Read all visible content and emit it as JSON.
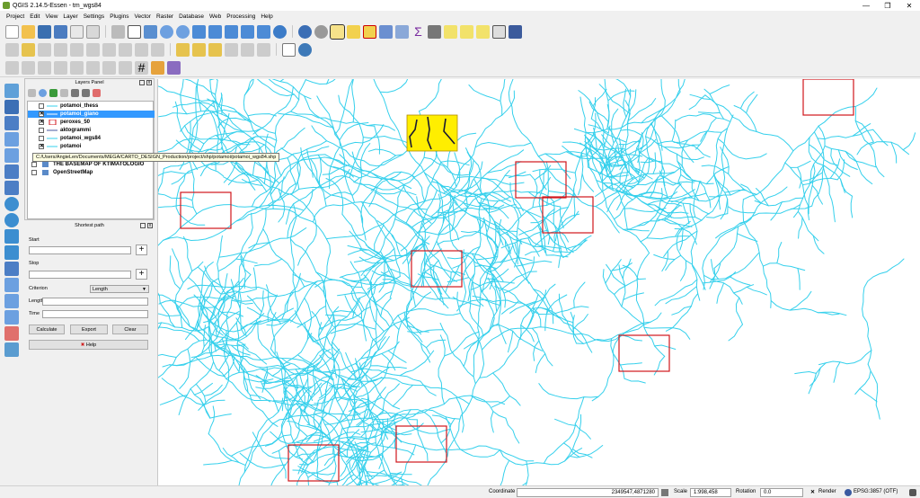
{
  "window": {
    "title": "QGIS 2.14.5-Essen - tm_wgs84",
    "min_label": "—",
    "max_label": "❐",
    "close_label": "✕"
  },
  "menu": [
    "Project",
    "Edit",
    "View",
    "Layer",
    "Settings",
    "Plugins",
    "Vector",
    "Raster",
    "Database",
    "Web",
    "Processing",
    "Help"
  ],
  "layers_panel": {
    "title": "Layers Panel",
    "layers": [
      {
        "name": "potamoi_thess",
        "checked": false,
        "selected": false,
        "symbol": "line"
      },
      {
        "name": "potamoi_giano",
        "checked": true,
        "selected": true,
        "symbol": "line"
      },
      {
        "name": "peroxes_50",
        "checked": true,
        "selected": false,
        "symbol": "poly-red"
      },
      {
        "name": "aktogrammi",
        "checked": false,
        "selected": false,
        "symbol": "line-dark"
      },
      {
        "name": "potamoi_wgs84",
        "checked": false,
        "selected": false,
        "symbol": "line"
      },
      {
        "name": "potamoi",
        "checked": true,
        "selected": false,
        "symbol": "line"
      },
      {
        "name": "THE BASEMAP OF KTIMATOLOGIO",
        "checked": false,
        "selected": false,
        "symbol": "raster"
      },
      {
        "name": "OpenStreetMap",
        "checked": false,
        "selected": false,
        "symbol": "raster"
      }
    ],
    "tooltip": "C:/Users/AngieLen/Documents/MEGA/CARTO_DESIGN_Production/project/shp/potamoi/potamoi_wgs84.shp"
  },
  "shortest_path": {
    "title": "Shortest path",
    "start_label": "Start",
    "stop_label": "Stop",
    "criterion_label": "Criterion",
    "criterion_value": "Length",
    "length_label": "Length",
    "time_label": "Time",
    "calculate_label": "Calculate",
    "export_label": "Export",
    "clear_label": "Clear",
    "help_label": "Help",
    "plus_label": "+"
  },
  "statusbar": {
    "coordinate_label": "Coordinate",
    "coordinate_value": "2349547,4871280",
    "scale_label": "Scale",
    "scale_value": "1:998,458",
    "rotation_label": "Rotation",
    "rotation_value": "0.0",
    "render_label": "Render",
    "crs_label": "EPSG:3857 (OTF)"
  },
  "colors": {
    "river": "#35d0ec",
    "square": "#d0161c",
    "highlight_fill": "#ffee00",
    "selection": "#3399ff"
  }
}
